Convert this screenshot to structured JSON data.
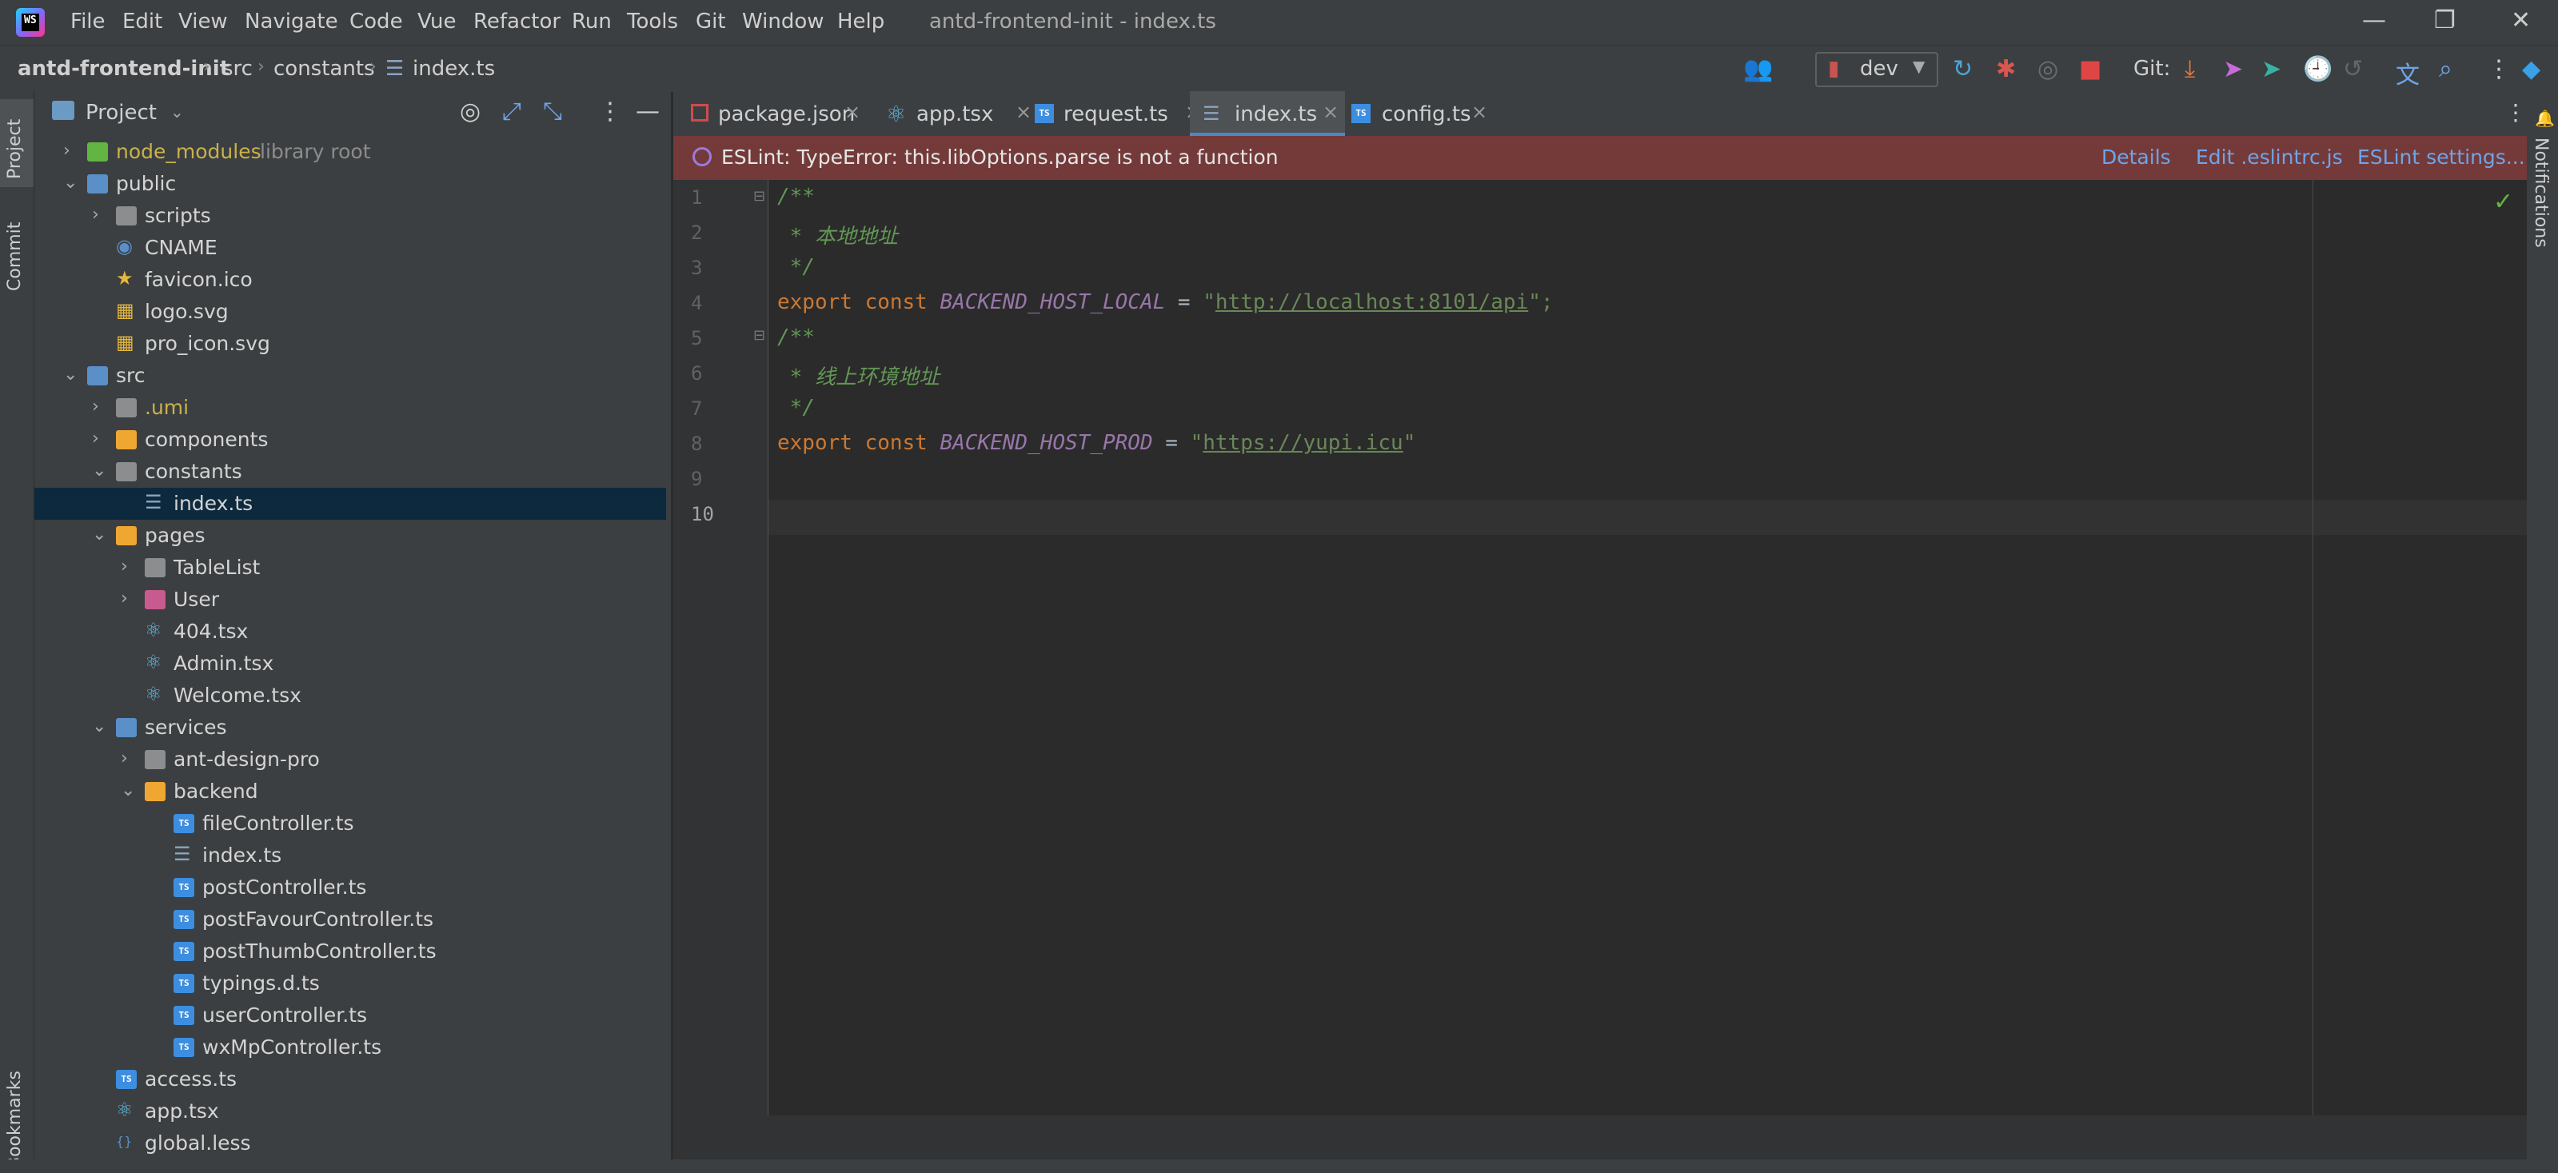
{
  "menu": [
    "File",
    "Edit",
    "View",
    "Navigate",
    "Code",
    "Vue",
    "Refactor",
    "Run",
    "Tools",
    "Git",
    "Window",
    "Help"
  ],
  "window_title": "antd-frontend-init - index.ts",
  "breadcrumb": [
    "antd-frontend-init",
    "src",
    "constants",
    "index.ts"
  ],
  "toolbar": {
    "branch": "dev",
    "git_label": "Git:"
  },
  "side_tabs": {
    "project": "Project",
    "commit": "Commit",
    "bookmarks": "Bookmarks",
    "notifications": "Notifications"
  },
  "project_panel": {
    "title": "Project",
    "tree": [
      {
        "label": "node_modules",
        "extra": "library root",
        "depth": 1,
        "arrow": "right",
        "icon": "folder-green"
      },
      {
        "label": "public",
        "depth": 1,
        "arrow": "down",
        "icon": "folder-blue"
      },
      {
        "label": "scripts",
        "depth": 2,
        "arrow": "right",
        "icon": "folder"
      },
      {
        "label": "CNAME",
        "depth": 2,
        "arrow": "",
        "icon": "globe"
      },
      {
        "label": "favicon.ico",
        "depth": 2,
        "arrow": "",
        "icon": "star"
      },
      {
        "label": "logo.svg",
        "depth": 2,
        "arrow": "",
        "icon": "svg"
      },
      {
        "label": "pro_icon.svg",
        "depth": 2,
        "arrow": "",
        "icon": "svg"
      },
      {
        "label": "src",
        "depth": 1,
        "arrow": "down",
        "icon": "folder-blue"
      },
      {
        "label": ".umi",
        "depth": 2,
        "arrow": "right",
        "icon": "folder"
      },
      {
        "label": "components",
        "depth": 2,
        "arrow": "right",
        "icon": "folder-orange"
      },
      {
        "label": "constants",
        "depth": 2,
        "arrow": "down",
        "icon": "folder"
      },
      {
        "label": "index.ts",
        "depth": 3,
        "arrow": "",
        "icon": "list",
        "selected": true
      },
      {
        "label": "pages",
        "depth": 2,
        "arrow": "down",
        "icon": "folder-orange"
      },
      {
        "label": "TableList",
        "depth": 3,
        "arrow": "right",
        "icon": "folder"
      },
      {
        "label": "User",
        "depth": 3,
        "arrow": "right",
        "icon": "folder-pink"
      },
      {
        "label": "404.tsx",
        "depth": 3,
        "arrow": "",
        "icon": "react"
      },
      {
        "label": "Admin.tsx",
        "depth": 3,
        "arrow": "",
        "icon": "react"
      },
      {
        "label": "Welcome.tsx",
        "depth": 3,
        "arrow": "",
        "icon": "react"
      },
      {
        "label": "services",
        "depth": 2,
        "arrow": "down",
        "icon": "folder-blue"
      },
      {
        "label": "ant-design-pro",
        "depth": 3,
        "arrow": "right",
        "icon": "folder"
      },
      {
        "label": "backend",
        "depth": 3,
        "arrow": "down",
        "icon": "folder-orange"
      },
      {
        "label": "fileController.ts",
        "depth": 4,
        "arrow": "",
        "icon": "ts"
      },
      {
        "label": "index.ts",
        "depth": 4,
        "arrow": "",
        "icon": "list"
      },
      {
        "label": "postController.ts",
        "depth": 4,
        "arrow": "",
        "icon": "ts"
      },
      {
        "label": "postFavourController.ts",
        "depth": 4,
        "arrow": "",
        "icon": "ts"
      },
      {
        "label": "postThumbController.ts",
        "depth": 4,
        "arrow": "",
        "icon": "ts"
      },
      {
        "label": "typings.d.ts",
        "depth": 4,
        "arrow": "",
        "icon": "ts"
      },
      {
        "label": "userController.ts",
        "depth": 4,
        "arrow": "",
        "icon": "ts"
      },
      {
        "label": "wxMpController.ts",
        "depth": 4,
        "arrow": "",
        "icon": "ts"
      },
      {
        "label": "access.ts",
        "depth": 2,
        "arrow": "",
        "icon": "ts"
      },
      {
        "label": "app.tsx",
        "depth": 2,
        "arrow": "",
        "icon": "react"
      },
      {
        "label": "global.less",
        "depth": 2,
        "arrow": "",
        "icon": "less"
      }
    ]
  },
  "tabs": [
    {
      "label": "package.json",
      "icon": "json"
    },
    {
      "label": "app.tsx",
      "icon": "react"
    },
    {
      "label": "request.ts",
      "icon": "ts"
    },
    {
      "label": "index.ts",
      "icon": "list",
      "active": true
    },
    {
      "label": "config.ts",
      "icon": "ts"
    }
  ],
  "banner": {
    "message": "ESLint: TypeError: this.libOptions.parse is not a function",
    "links": [
      "Details",
      "Edit .eslintrc.js",
      "ESLint settings..."
    ]
  },
  "editor": {
    "line_numbers": [
      "1",
      "2",
      "3",
      "4",
      "5",
      "6",
      "7",
      "8",
      "9",
      "10"
    ],
    "code": {
      "l1": "/**",
      "l2": " * 本地地址",
      "l3": " */",
      "l4_kw": "export const ",
      "l4_name": "BACKEND_HOST_LOCAL",
      "l4_eq": " = ",
      "l4_q1": "\"",
      "l4_url": "http://localhost:8101/api",
      "l4_q2": "\";",
      "l5": "/**",
      "l6": " * 线上环境地址",
      "l7": " */",
      "l8_kw": "export const ",
      "l8_name": "BACKEND_HOST_PROD",
      "l8_eq": " = ",
      "l8_q1": "\"",
      "l8_url": "https://yupi.icu",
      "l8_q2": "\""
    }
  }
}
